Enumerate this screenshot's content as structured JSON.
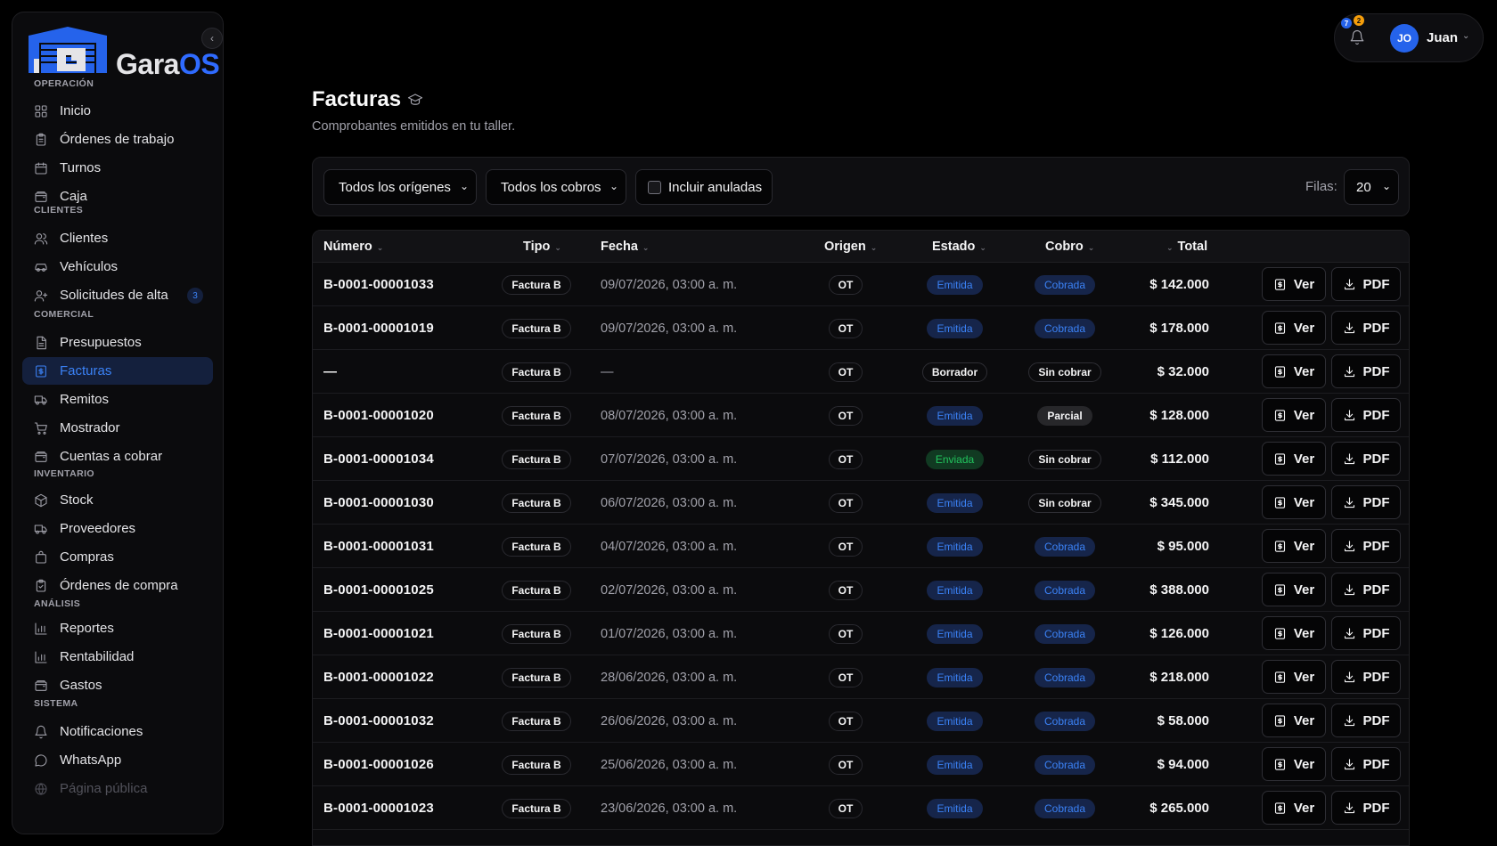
{
  "brand": {
    "name_part1": "Gara",
    "name_part2": "OS",
    "primary": "#2563eb",
    "accent": "#2f6bff"
  },
  "sidebar": {
    "collapse_icon": "chevron-left-icon",
    "sections": [
      {
        "label": "OPERACIÓN",
        "items": [
          {
            "label": "Inicio",
            "icon": "grid-icon"
          },
          {
            "label": "Órdenes de trabajo",
            "icon": "clipboard-icon"
          },
          {
            "label": "Turnos",
            "icon": "calendar-icon"
          },
          {
            "label": "Caja",
            "icon": "wallet-icon"
          }
        ]
      },
      {
        "label": "CLIENTES",
        "items": [
          {
            "label": "Clientes",
            "icon": "users-icon"
          },
          {
            "label": "Vehículos",
            "icon": "car-icon"
          },
          {
            "label": "Solicitudes de alta",
            "icon": "user-plus-icon",
            "badge": "3"
          }
        ]
      },
      {
        "label": "COMERCIAL",
        "items": [
          {
            "label": "Presupuestos",
            "icon": "file-text-icon"
          },
          {
            "label": "Facturas",
            "icon": "receipt-icon",
            "active": true
          },
          {
            "label": "Remitos",
            "icon": "truck-icon"
          },
          {
            "label": "Mostrador",
            "icon": "cart-icon"
          },
          {
            "label": "Cuentas a cobrar",
            "icon": "wallet-icon"
          }
        ]
      },
      {
        "label": "INVENTARIO",
        "items": [
          {
            "label": "Stock",
            "icon": "box-icon"
          },
          {
            "label": "Proveedores",
            "icon": "truck-icon"
          },
          {
            "label": "Compras",
            "icon": "bag-icon"
          },
          {
            "label": "Órdenes de compra",
            "icon": "clipboard-check-icon"
          }
        ]
      },
      {
        "label": "ANÁLISIS",
        "items": [
          {
            "label": "Reportes",
            "icon": "bar-chart-icon"
          },
          {
            "label": "Rentabilidad",
            "icon": "bar-chart-icon"
          },
          {
            "label": "Gastos",
            "icon": "wallet-icon"
          }
        ]
      },
      {
        "label": "SISTEMA",
        "items": [
          {
            "label": "Notificaciones",
            "icon": "bell-icon"
          },
          {
            "label": "WhatsApp",
            "icon": "message-icon"
          },
          {
            "label": "Página pública",
            "icon": "globe-icon",
            "faded": true
          }
        ]
      }
    ]
  },
  "topbar": {
    "notif_count_blue": "7",
    "notif_count_amber": "2",
    "avatar_initials": "JO",
    "user_name": "Juan"
  },
  "page": {
    "title": "Facturas",
    "subtitle": "Comprobantes emitidos en tu taller."
  },
  "filters": {
    "origen": "Todos los orígenes",
    "cobro": "Todos los cobros",
    "incluir_anuladas": "Incluir anuladas",
    "filas_label": "Filas:",
    "filas_value": "20"
  },
  "table": {
    "headers": {
      "numero": "Número",
      "tipo": "Tipo",
      "fecha": "Fecha",
      "origen": "Origen",
      "estado": "Estado",
      "cobro": "Cobro",
      "total": "Total"
    },
    "btn_ver": "Ver",
    "btn_pdf": "PDF",
    "rows": [
      {
        "numero": "B-0001-00001033",
        "tipo": "Factura B",
        "fecha": "09/07/2026, 03:00 a. m.",
        "origen": "OT",
        "estado": "Emitida",
        "cobro": "Cobrada",
        "total": "$ 142.000"
      },
      {
        "numero": "B-0001-00001019",
        "tipo": "Factura B",
        "fecha": "09/07/2026, 03:00 a. m.",
        "origen": "OT",
        "estado": "Emitida",
        "cobro": "Cobrada",
        "total": "$ 178.000"
      },
      {
        "numero": "—",
        "tipo": "Factura B",
        "fecha": "—",
        "origen": "OT",
        "estado": "Borrador",
        "cobro": "Sin cobrar",
        "total": "$ 32.000"
      },
      {
        "numero": "B-0001-00001020",
        "tipo": "Factura B",
        "fecha": "08/07/2026, 03:00 a. m.",
        "origen": "OT",
        "estado": "Emitida",
        "cobro": "Parcial",
        "total": "$ 128.000"
      },
      {
        "numero": "B-0001-00001034",
        "tipo": "Factura B",
        "fecha": "07/07/2026, 03:00 a. m.",
        "origen": "OT",
        "estado": "Enviada",
        "cobro": "Sin cobrar",
        "total": "$ 112.000"
      },
      {
        "numero": "B-0001-00001030",
        "tipo": "Factura B",
        "fecha": "06/07/2026, 03:00 a. m.",
        "origen": "OT",
        "estado": "Emitida",
        "cobro": "Sin cobrar",
        "total": "$ 345.000"
      },
      {
        "numero": "B-0001-00001031",
        "tipo": "Factura B",
        "fecha": "04/07/2026, 03:00 a. m.",
        "origen": "OT",
        "estado": "Emitida",
        "cobro": "Cobrada",
        "total": "$ 95.000"
      },
      {
        "numero": "B-0001-00001025",
        "tipo": "Factura B",
        "fecha": "02/07/2026, 03:00 a. m.",
        "origen": "OT",
        "estado": "Emitida",
        "cobro": "Cobrada",
        "total": "$ 388.000"
      },
      {
        "numero": "B-0001-00001021",
        "tipo": "Factura B",
        "fecha": "01/07/2026, 03:00 a. m.",
        "origen": "OT",
        "estado": "Emitida",
        "cobro": "Cobrada",
        "total": "$ 126.000"
      },
      {
        "numero": "B-0001-00001022",
        "tipo": "Factura B",
        "fecha": "28/06/2026, 03:00 a. m.",
        "origen": "OT",
        "estado": "Emitida",
        "cobro": "Cobrada",
        "total": "$ 218.000"
      },
      {
        "numero": "B-0001-00001032",
        "tipo": "Factura B",
        "fecha": "26/06/2026, 03:00 a. m.",
        "origen": "OT",
        "estado": "Emitida",
        "cobro": "Cobrada",
        "total": "$ 58.000"
      },
      {
        "numero": "B-0001-00001026",
        "tipo": "Factura B",
        "fecha": "25/06/2026, 03:00 a. m.",
        "origen": "OT",
        "estado": "Emitida",
        "cobro": "Cobrada",
        "total": "$ 94.000"
      },
      {
        "numero": "B-0001-00001023",
        "tipo": "Factura B",
        "fecha": "23/06/2026, 03:00 a. m.",
        "origen": "OT",
        "estado": "Emitida",
        "cobro": "Cobrada",
        "total": "$ 265.000"
      }
    ]
  }
}
